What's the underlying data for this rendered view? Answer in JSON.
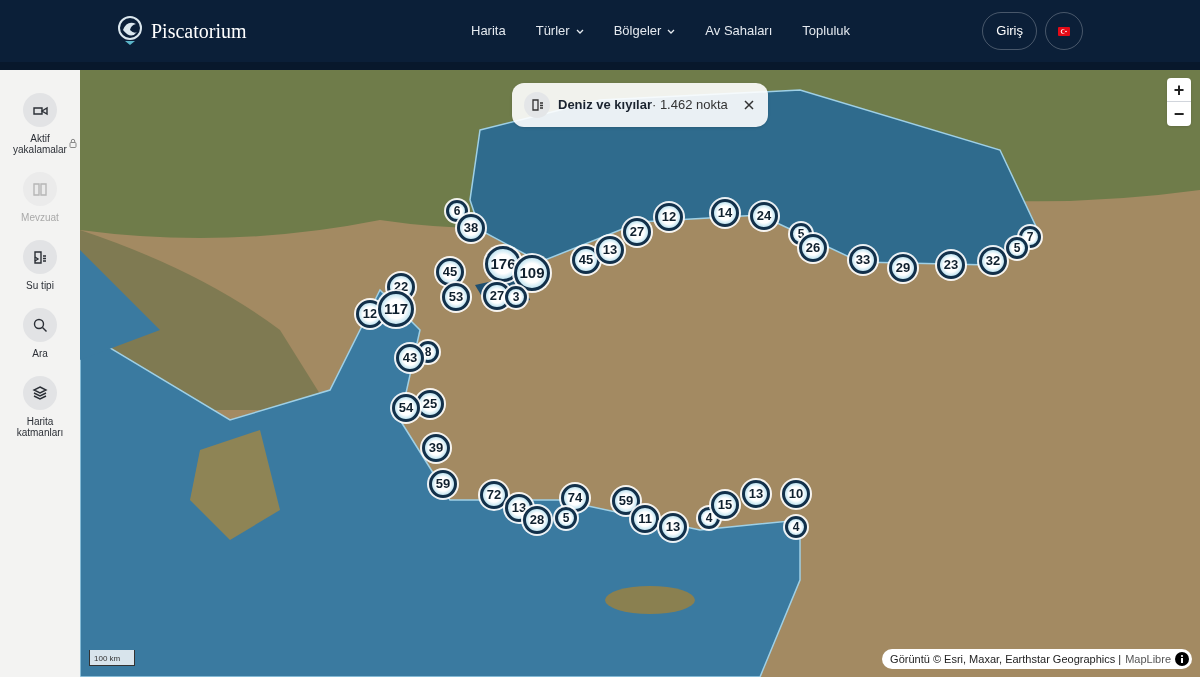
{
  "header": {
    "brand": "Piscatorium",
    "nav": [
      {
        "label": "Harita",
        "dropdown": false
      },
      {
        "label": "Türler",
        "dropdown": true
      },
      {
        "label": "Bölgeler",
        "dropdown": true
      },
      {
        "label": "Av Sahaları",
        "dropdown": false
      },
      {
        "label": "Topluluk",
        "dropdown": false
      }
    ],
    "login": "Giriş"
  },
  "sidebar": {
    "items": [
      {
        "label": "Aktif yakalamalar",
        "kind": "fish",
        "disabled": false,
        "locked": true
      },
      {
        "label": "Mevzuat",
        "kind": "book",
        "disabled": true,
        "locked": false
      },
      {
        "label": "Su tipi",
        "kind": "water",
        "disabled": false,
        "locked": false
      },
      {
        "label": "Ara",
        "kind": "search",
        "disabled": false,
        "locked": false
      },
      {
        "label": "Harita katmanları",
        "kind": "layers",
        "disabled": false,
        "locked": false
      }
    ]
  },
  "filter_chip": {
    "title": "Deniz ve kıyılar",
    "count": "· 1.462 nokta"
  },
  "zoom": {
    "in": "+",
    "out": "−"
  },
  "scale": "100 km",
  "attribution": {
    "text": "Görüntü © Esri, Maxar, Earthstar Geographics |",
    "link": "MapLibre"
  },
  "clusters": [
    {
      "count": "6"
    },
    {
      "count": "38"
    },
    {
      "count": "22"
    },
    {
      "count": "12"
    },
    {
      "count": "117"
    },
    {
      "count": "45"
    },
    {
      "count": "53"
    },
    {
      "count": "176"
    },
    {
      "count": "109"
    },
    {
      "count": "27"
    },
    {
      "count": "3"
    },
    {
      "count": "8"
    },
    {
      "count": "43"
    },
    {
      "count": "25"
    },
    {
      "count": "54"
    },
    {
      "count": "39"
    },
    {
      "count": "59"
    },
    {
      "count": "72"
    },
    {
      "count": "13"
    },
    {
      "count": "28"
    },
    {
      "count": "74"
    },
    {
      "count": "5"
    },
    {
      "count": "59"
    },
    {
      "count": "11"
    },
    {
      "count": "13"
    },
    {
      "count": "4"
    },
    {
      "count": "15"
    },
    {
      "count": "13"
    },
    {
      "count": "10"
    },
    {
      "count": "4"
    },
    {
      "count": "45"
    },
    {
      "count": "13"
    },
    {
      "count": "27"
    },
    {
      "count": "12"
    },
    {
      "count": "14"
    },
    {
      "count": "24"
    },
    {
      "count": "5"
    },
    {
      "count": "26"
    },
    {
      "count": "33"
    },
    {
      "count": "29"
    },
    {
      "count": "23"
    },
    {
      "count": "32"
    },
    {
      "count": "7"
    },
    {
      "count": "5"
    }
  ]
}
